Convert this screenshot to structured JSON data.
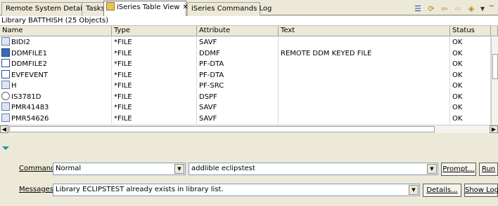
{
  "tabs": [
    {
      "label": "Remote System Details"
    },
    {
      "label": "Tasks"
    },
    {
      "label": "iSeries Table View",
      "active": true,
      "close_glyph": "✕"
    },
    {
      "label": "iSeries Commands Log"
    }
  ],
  "toolbar": {
    "icons": [
      "filter-icon",
      "refresh-icon",
      "back-icon",
      "forward-icon",
      "collapse-icon",
      "menu-icon",
      "minimize-icon"
    ]
  },
  "summary": "Library BATTHISH (25 Objects)",
  "table": {
    "columns": [
      "Name",
      "Type",
      "Attribute",
      "Text",
      "Status",
      ""
    ],
    "rows": [
      {
        "name": "BIDI2",
        "type": "*FILE",
        "attribute": "SAVF",
        "text": "",
        "status": "OK",
        "icon": "save-file-icon"
      },
      {
        "name": "DDMFILE1",
        "type": "*FILE",
        "attribute": "DDMF",
        "text": "REMOTE DDM KEYED FILE",
        "status": "OK",
        "icon": "ddm-file-icon"
      },
      {
        "name": "DDMFILE2",
        "type": "*FILE",
        "attribute": "PF-DTA",
        "text": "",
        "status": "OK",
        "icon": "physical-file-icon"
      },
      {
        "name": "EVFEVENT",
        "type": "*FILE",
        "attribute": "PF-DTA",
        "text": "",
        "status": "OK",
        "icon": "physical-file-icon"
      },
      {
        "name": "H",
        "type": "*FILE",
        "attribute": "PF-SRC",
        "text": "",
        "status": "OK",
        "icon": "source-file-icon"
      },
      {
        "name": "IS3781D",
        "type": "*FILE",
        "attribute": "DSPF",
        "text": "",
        "status": "OK",
        "icon": "display-file-icon"
      },
      {
        "name": "PMR41483",
        "type": "*FILE",
        "attribute": "SAVF",
        "text": "",
        "status": "OK",
        "icon": "save-file-icon"
      },
      {
        "name": "PMR54626",
        "type": "*FILE",
        "attribute": "SAVF",
        "text": "",
        "status": "OK",
        "icon": "save-file-icon"
      }
    ]
  },
  "command": {
    "label": "Command",
    "mode": "Normal",
    "value": "addlible eclipstest",
    "prompt_label": "Prompt...",
    "run_label": "Run"
  },
  "messages": {
    "label": "Messages",
    "value": "Library ECLIPSTEST already exists in library list.",
    "details_label": "Details...",
    "show_log_label": "Show Log"
  }
}
